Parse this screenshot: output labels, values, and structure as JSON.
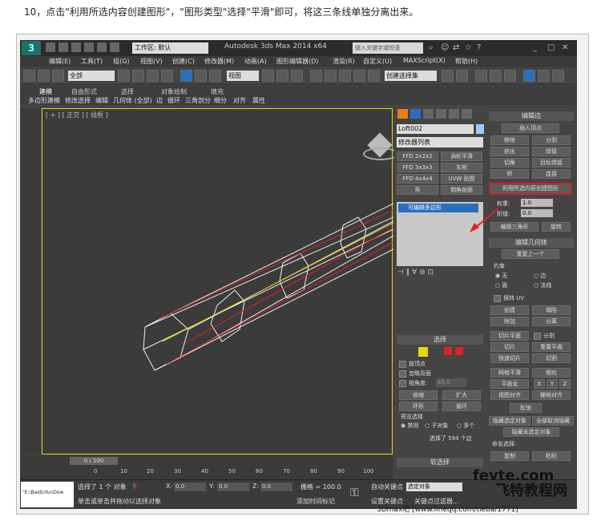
{
  "caption": "10，点击\"利用所选内容创建图形\"，\"图形类型\"选择\"平滑\"即可，将这三条线单独分离出来。",
  "title_bar": {
    "logo": "3",
    "workspace": "工作区: 默认",
    "app_title": "Autodesk 3ds Max  2014 x64",
    "search_placeholder": "键入关键字或短语"
  },
  "menu": [
    "编辑(E)",
    "工具(T)",
    "组(G)",
    "视图(V)",
    "创建(C)",
    "修改器(M)",
    "动画(A)",
    "图形编辑器(D)",
    "渲染(R)",
    "自定义(U)",
    "MAXScript(X)",
    "帮助(H)"
  ],
  "toolbar": {
    "filter": "全部",
    "refcoord": "视图",
    "selset": "创建选择集"
  },
  "ribbon": {
    "tabs": [
      "建模",
      "自由形式",
      "选择",
      "对象绘制",
      "填充"
    ],
    "sub": [
      "多边形建模",
      "修改选择",
      "编辑",
      "几何体 (全部)",
      "边",
      "循环",
      "三角剖分",
      "细分",
      "对齐",
      "属性"
    ]
  },
  "viewport": {
    "label": "[ + ] [ 正交 ] [ 线框 ]"
  },
  "timeline": {
    "frame": "0 / 100",
    "ticks": [
      "0",
      "10",
      "20",
      "30",
      "40",
      "50",
      "60",
      "70",
      "80",
      "90",
      "100"
    ]
  },
  "status": {
    "maxscript": "\"E:\\BaiduYunDow",
    "sel": "选择了 1 个 对象",
    "hint": "单击或单击并拖动以选择对象",
    "x": "0.0",
    "y": "0.0",
    "z": "0.0",
    "grid": "栅格 = 100.0",
    "autokey": "自动关键点",
    "setkey": "设置关键点",
    "keysel": "选定对象",
    "addtime": "添加时间标记",
    "keyfilter": "关键点过滤器..."
  },
  "cmd": {
    "objname": "Loft002",
    "modlist": "修改器列表",
    "buttons": [
      [
        "FFD 2x2x2",
        "涡轮平滑"
      ],
      [
        "FFD 3x3x3",
        "车削"
      ],
      [
        "FFD 4x4x4",
        "UVW 贴图"
      ],
      [
        "壳",
        "倒角剖面"
      ]
    ],
    "stack_item": "可编辑多边形",
    "select_title": "选择",
    "by_vertex": "按顶点",
    "ignore_back": "忽略背面",
    "by_angle": "按角度:",
    "angle_val": "45.0",
    "shrink": "收缩",
    "grow": "扩大",
    "ring": "环形",
    "loop": "循环",
    "preview_title": "预览选择",
    "preview": [
      "禁用",
      "子对象",
      "多个"
    ],
    "sel_info": "选择了 594 个边",
    "soft_sel": "软选择"
  },
  "right": {
    "edit_edges": "编辑边",
    "insert_vertex": "插入顶点",
    "rows": [
      [
        "移除",
        "分割"
      ],
      [
        "挤出",
        "焊接"
      ],
      [
        "切角",
        "目标焊接"
      ],
      [
        "桥",
        "连接"
      ]
    ],
    "create_shape": "利用所选内容创建图形",
    "weight_label": "权重:",
    "weight": "1.0",
    "crease_label": "折缝:",
    "crease": "0.0",
    "edit_tri": "编辑三角形",
    "turn": "旋转",
    "edit_geo": "编辑几何体",
    "repeat": "重复上一个",
    "constraint": "约束",
    "c_none": "无",
    "c_edge": "边",
    "c_face": "面",
    "c_normal": "法线",
    "keep_uv": "保持 UV",
    "create": "创建",
    "collapse": "塌陷",
    "attach": "附加",
    "detach": "分离",
    "slice_plane": "切片平面",
    "split": "分割",
    "slice": "切片",
    "reset_plane": "重置平面",
    "quick_slice": "快速切片",
    "cut": "切割",
    "meshsmooth": "网格平滑",
    "tessellate": "细化",
    "planar": "平面化",
    "xyz": [
      "X",
      "Y",
      "Z"
    ],
    "view_align": "视图对齐",
    "grid_align": "栅格对齐",
    "relax": "松弛",
    "hide_sel": "隐藏选定对象",
    "unhide_all": "全部取消隐藏",
    "hide_unsel": "隐藏未选定对象",
    "named_sel": "命名选择:",
    "copy": "复制",
    "paste": "粘贴"
  },
  "watermark": {
    "site1": "fevte.com",
    "site2": "飞特教程网",
    "credit": "3Dmax吧  [www.lineqq.com/tieba/1771]"
  }
}
